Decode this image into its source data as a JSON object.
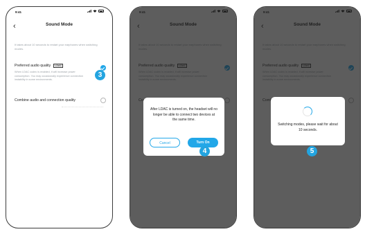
{
  "status_bar": {
    "time": "9:41"
  },
  "header": {
    "back_icon": "‹",
    "title": "Sound Mode"
  },
  "description": "It takes about 10 seconds to restart your earphones when switching modes.",
  "options": {
    "preferred": {
      "label": "Preferred audio quality",
      "badge": "LDAC",
      "description": "When LDAC codec is enabled, it will increase power consumption. You may occasionally experience connection instability in some environments."
    },
    "combine": {
      "label": "Combine audio and connection quality"
    }
  },
  "dialog": {
    "message": "After LDAC is turned on, the headset will no longer be able to connect two devices at the same time.",
    "cancel_label": "Cancel",
    "confirm_label": "Turn On"
  },
  "switching": {
    "message": "Switching modes, please wait for about 10 seconds."
  },
  "steps": {
    "s3": "3",
    "s4": "4",
    "s5": "5"
  },
  "colors": {
    "accent": "#22a7e8",
    "step_badge": "#23a4e0",
    "overlay": "#2d2d2d"
  }
}
